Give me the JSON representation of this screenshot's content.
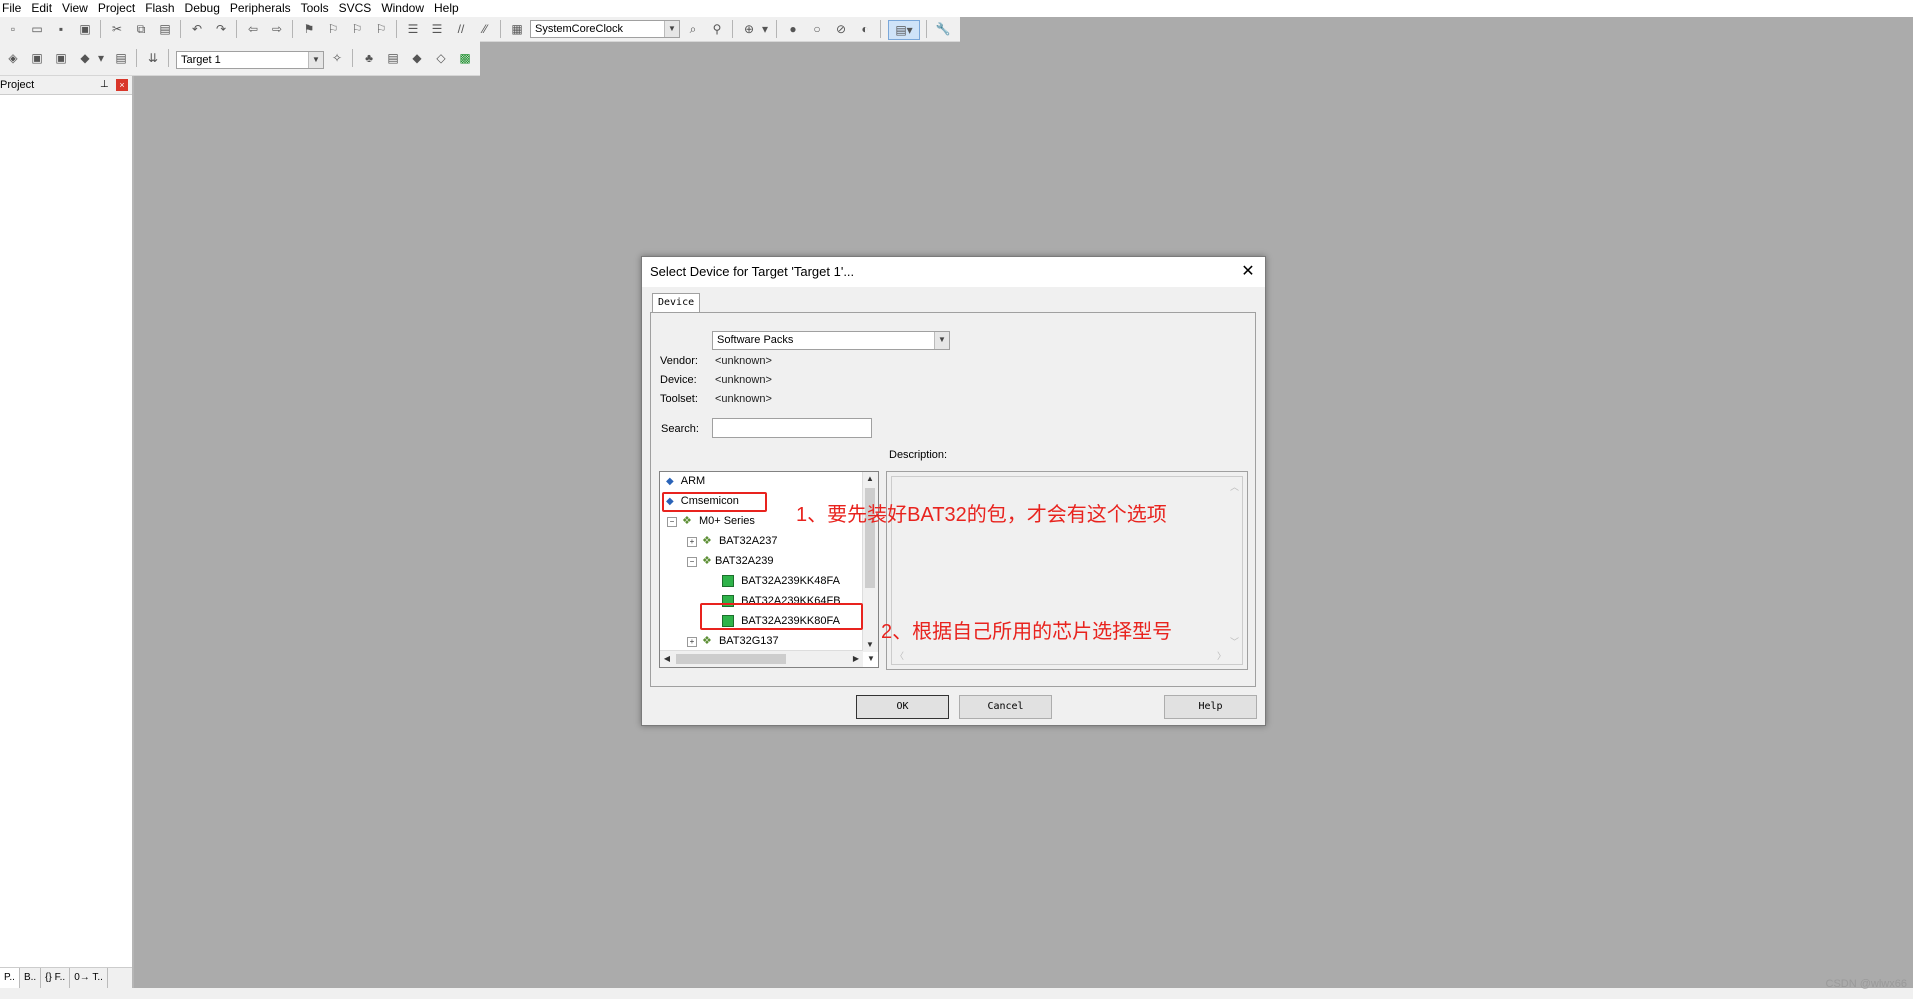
{
  "menu": [
    "File",
    "Edit",
    "View",
    "Project",
    "Flash",
    "Debug",
    "Peripherals",
    "Tools",
    "SVCS",
    "Window",
    "Help"
  ],
  "toolbar": {
    "find_combo": "SystemCoreClock",
    "target_combo": "Target 1"
  },
  "project_panel": {
    "title": "Project",
    "tabs": [
      "P..",
      "B..",
      "{} F..",
      "0→ T.."
    ]
  },
  "dialog": {
    "title": "Select Device for Target 'Target 1'...",
    "tab": "Device",
    "source_select": "Software Packs",
    "vendor_label": "Vendor:",
    "vendor_value": "<unknown>",
    "device_label": "Device:",
    "device_value": "<unknown>",
    "toolset_label": "Toolset:",
    "toolset_value": "<unknown>",
    "search_label": "Search:",
    "search_value": "",
    "description_label": "Description:",
    "tree": [
      {
        "label": "ARM"
      },
      {
        "label": "Cmsemicon"
      },
      {
        "label": "M0+ Series"
      },
      {
        "label": "BAT32A237"
      },
      {
        "label": "BAT32A239"
      },
      {
        "label": "BAT32A239KK48FA"
      },
      {
        "label": "BAT32A239KK64FB"
      },
      {
        "label": "BAT32A239KK80FA"
      },
      {
        "label": "BAT32G137"
      }
    ],
    "ok_label": "OK",
    "cancel_label": "Cancel",
    "help_label": "Help"
  },
  "annotations": {
    "note1": "1、要先装好BAT32的包，才会有这个选项",
    "note2": "2、根据自己所用的芯片选择型号",
    "color": "#e8231e"
  },
  "watermark": "CSDN @wlwx66"
}
